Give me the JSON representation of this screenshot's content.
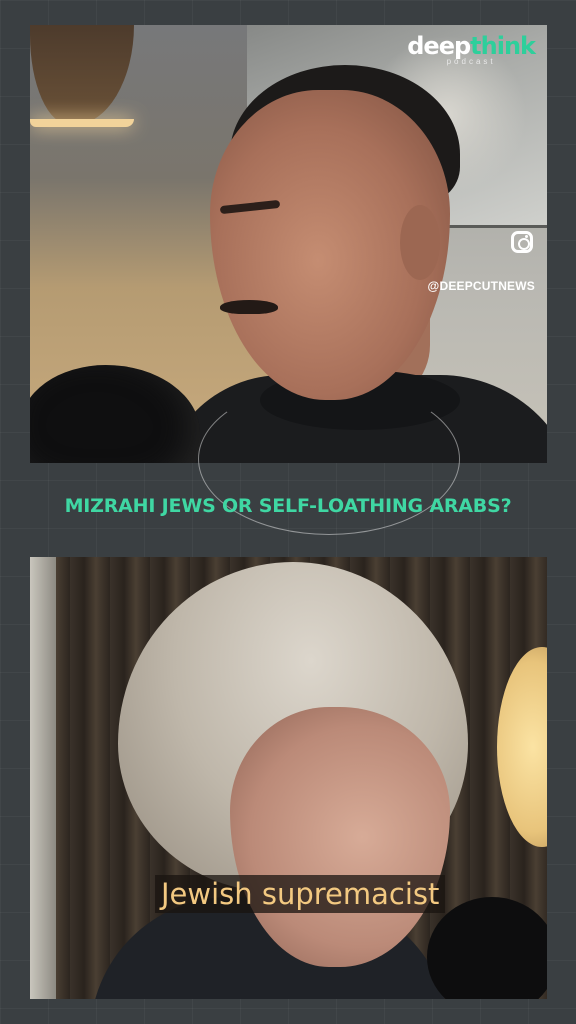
{
  "logo": {
    "primary": "deep",
    "accent": "think",
    "subtitle": "podcast"
  },
  "social": {
    "icon": "instagram-icon",
    "handle": "@DEEPCUTNEWS"
  },
  "headline": "MIZRAHI JEWS OR SELF-LOATHING ARABS?",
  "caption": "Jewish supremacist",
  "colors": {
    "accent": "#3fd7a3",
    "caption": "#f3c981",
    "background": "#3a3f42"
  }
}
